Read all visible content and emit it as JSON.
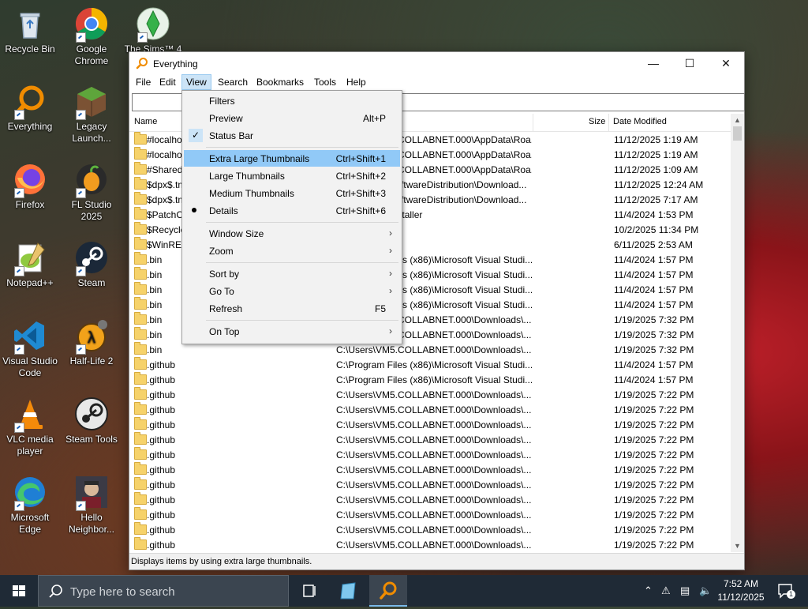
{
  "desktop_icons": [
    {
      "label": "Recycle Bin",
      "icon": "recycle-bin-icon"
    },
    {
      "label": "Google Chrome",
      "icon": "chrome-icon"
    },
    {
      "label": "The Sims™ 4",
      "icon": "sims-icon"
    },
    {
      "label": "Everything",
      "icon": "everything-icon"
    },
    {
      "label": "Legacy Launch...",
      "icon": "minecraft-icon"
    },
    {
      "label": "Firefox",
      "icon": "firefox-icon"
    },
    {
      "label": "FL Studio 2025",
      "icon": "fl-studio-icon"
    },
    {
      "label": "Notepad++",
      "icon": "notepad-plus-icon"
    },
    {
      "label": "Steam",
      "icon": "steam-icon"
    },
    {
      "label": "Visual Studio Code",
      "icon": "vscode-icon"
    },
    {
      "label": "Half-Life 2",
      "icon": "half-life-icon"
    },
    {
      "label": "VLC media player",
      "icon": "vlc-icon"
    },
    {
      "label": "Steam Tools",
      "icon": "steam-tools-icon"
    },
    {
      "label": "Microsoft Edge",
      "icon": "edge-icon"
    },
    {
      "label": "Hello Neighbor...",
      "icon": "hello-neighbor-icon"
    }
  ],
  "window": {
    "title": "Everything",
    "menus": [
      "File",
      "Edit",
      "View",
      "Search",
      "Bookmarks",
      "Tools",
      "Help"
    ],
    "active_menu": "View",
    "search_value": "",
    "columns": {
      "name": "Name",
      "path": "Path",
      "size": "Size",
      "date": "Date Modified"
    },
    "rows": [
      {
        "name": "#localhost",
        "path": "C:\\Users\\VM5.COLLABNET.000\\AppData\\Roa...",
        "date": "11/12/2025 1:19 AM"
      },
      {
        "name": "#localhost",
        "path": "C:\\Users\\VM5.COLLABNET.000\\AppData\\Roa...",
        "date": "11/12/2025 1:19 AM"
      },
      {
        "name": "#SharedObjects",
        "path": "C:\\Users\\VM5.COLLABNET.000\\AppData\\Roa...",
        "date": "11/12/2025 1:09 AM"
      },
      {
        "name": "$dpx$.tmp",
        "path": "C:\\Windows\\SoftwareDistribution\\Download...",
        "date": "11/12/2025 12:24 AM"
      },
      {
        "name": "$dpx$.tmp",
        "path": "C:\\Windows\\SoftwareDistribution\\Download...",
        "date": "11/12/2025 7:17 AM"
      },
      {
        "name": "$PatchCache$",
        "path": "C:\\Windows\\Installer",
        "date": "11/4/2024 1:53 PM"
      },
      {
        "name": "$Recycle.Bin",
        "path": "C:",
        "date": "10/2/2025 11:34 PM"
      },
      {
        "name": "$WinREAgent",
        "path": "C:",
        "date": "6/11/2025 2:53 AM"
      },
      {
        "name": ".bin",
        "path": "C:\\Program Files (x86)\\Microsoft Visual Studi...",
        "date": "11/4/2024 1:57 PM"
      },
      {
        "name": ".bin",
        "path": "C:\\Program Files (x86)\\Microsoft Visual Studi...",
        "date": "11/4/2024 1:57 PM"
      },
      {
        "name": ".bin",
        "path": "C:\\Program Files (x86)\\Microsoft Visual Studi...",
        "date": "11/4/2024 1:57 PM"
      },
      {
        "name": ".bin",
        "path": "C:\\Program Files (x86)\\Microsoft Visual Studi...",
        "date": "11/4/2024 1:57 PM"
      },
      {
        "name": ".bin",
        "path": "C:\\Users\\VM5.COLLABNET.000\\Downloads\\...",
        "date": "1/19/2025 7:32 PM"
      },
      {
        "name": ".bin",
        "path": "C:\\Users\\VM5.COLLABNET.000\\Downloads\\...",
        "date": "1/19/2025 7:32 PM"
      },
      {
        "name": ".bin",
        "path": "C:\\Users\\VM5.COLLABNET.000\\Downloads\\...",
        "date": "1/19/2025 7:32 PM"
      },
      {
        "name": ".github",
        "path": "C:\\Program Files (x86)\\Microsoft Visual Studi...",
        "date": "11/4/2024 1:57 PM"
      },
      {
        "name": ".github",
        "path": "C:\\Program Files (x86)\\Microsoft Visual Studi...",
        "date": "11/4/2024 1:57 PM"
      },
      {
        "name": ".github",
        "path": "C:\\Users\\VM5.COLLABNET.000\\Downloads\\...",
        "date": "1/19/2025 7:22 PM"
      },
      {
        "name": ".github",
        "path": "C:\\Users\\VM5.COLLABNET.000\\Downloads\\...",
        "date": "1/19/2025 7:22 PM"
      },
      {
        "name": ".github",
        "path": "C:\\Users\\VM5.COLLABNET.000\\Downloads\\...",
        "date": "1/19/2025 7:22 PM"
      },
      {
        "name": ".github",
        "path": "C:\\Users\\VM5.COLLABNET.000\\Downloads\\...",
        "date": "1/19/2025 7:22 PM"
      },
      {
        "name": ".github",
        "path": "C:\\Users\\VM5.COLLABNET.000\\Downloads\\...",
        "date": "1/19/2025 7:22 PM"
      },
      {
        "name": ".github",
        "path": "C:\\Users\\VM5.COLLABNET.000\\Downloads\\...",
        "date": "1/19/2025 7:22 PM"
      },
      {
        "name": ".github",
        "path": "C:\\Users\\VM5.COLLABNET.000\\Downloads\\...",
        "date": "1/19/2025 7:22 PM"
      },
      {
        "name": ".github",
        "path": "C:\\Users\\VM5.COLLABNET.000\\Downloads\\...",
        "date": "1/19/2025 7:22 PM"
      },
      {
        "name": ".github",
        "path": "C:\\Users\\VM5.COLLABNET.000\\Downloads\\...",
        "date": "1/19/2025 7:22 PM"
      },
      {
        "name": ".github",
        "path": "C:\\Users\\VM5.COLLABNET.000\\Downloads\\...",
        "date": "1/19/2025 7:22 PM"
      },
      {
        "name": ".github",
        "path": "C:\\Users\\VM5.COLLABNET.000\\Downloads\\...",
        "date": "1/19/2025 7:22 PM"
      }
    ],
    "status": "Displays items by using extra large thumbnails."
  },
  "view_menu": [
    {
      "label": "Filters",
      "shortcut": "",
      "state": "none",
      "submenu": false,
      "highlighted": false
    },
    {
      "label": "Preview",
      "shortcut": "Alt+P",
      "state": "none",
      "submenu": false,
      "highlighted": false
    },
    {
      "label": "Status Bar",
      "shortcut": "",
      "state": "check",
      "submenu": false,
      "highlighted": false
    },
    {
      "sep": true
    },
    {
      "label": "Extra Large Thumbnails",
      "shortcut": "Ctrl+Shift+1",
      "state": "none",
      "submenu": false,
      "highlighted": true
    },
    {
      "label": "Large Thumbnails",
      "shortcut": "Ctrl+Shift+2",
      "state": "none",
      "submenu": false,
      "highlighted": false
    },
    {
      "label": "Medium Thumbnails",
      "shortcut": "Ctrl+Shift+3",
      "state": "none",
      "submenu": false,
      "highlighted": false
    },
    {
      "label": "Details",
      "shortcut": "Ctrl+Shift+6",
      "state": "radio",
      "submenu": false,
      "highlighted": false
    },
    {
      "sep": true
    },
    {
      "label": "Window Size",
      "shortcut": "",
      "state": "none",
      "submenu": true,
      "highlighted": false
    },
    {
      "label": "Zoom",
      "shortcut": "",
      "state": "none",
      "submenu": true,
      "highlighted": false
    },
    {
      "sep": true
    },
    {
      "label": "Sort by",
      "shortcut": "",
      "state": "none",
      "submenu": true,
      "highlighted": false
    },
    {
      "label": "Go To",
      "shortcut": "",
      "state": "none",
      "submenu": true,
      "highlighted": false
    },
    {
      "label": "Refresh",
      "shortcut": "F5",
      "state": "none",
      "submenu": false,
      "highlighted": false
    },
    {
      "sep": true
    },
    {
      "label": "On Top",
      "shortcut": "",
      "state": "none",
      "submenu": true,
      "highlighted": false
    }
  ],
  "taskbar": {
    "search_placeholder": "Type here to search",
    "time": "7:52 AM",
    "date": "11/12/2025",
    "notification_count": "1"
  },
  "colors": {
    "accent": "#91c9f7",
    "menu_active": "#cce4f7",
    "everything_orange": "#f08c00"
  }
}
